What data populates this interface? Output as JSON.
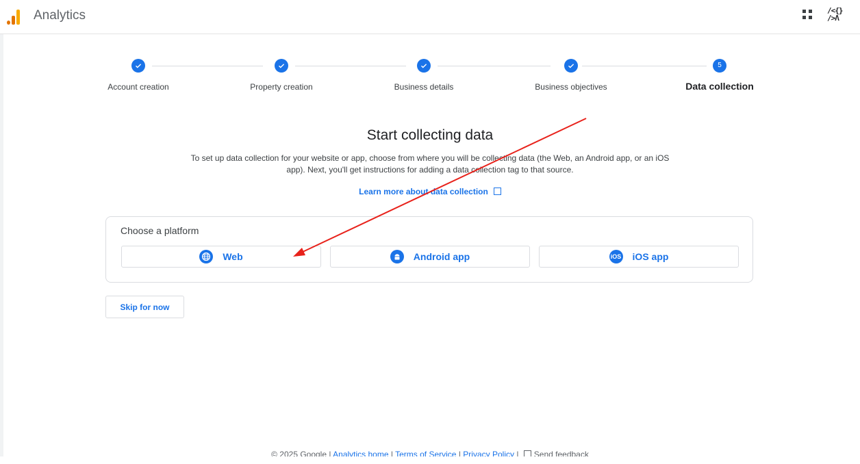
{
  "topbar": {
    "app_title": "Analytics",
    "account_icon_text": "/<{}\n/>Λ"
  },
  "stepper": {
    "steps": [
      {
        "label": "Account creation",
        "state": "done"
      },
      {
        "label": "Property creation",
        "state": "done"
      },
      {
        "label": "Business details",
        "state": "done"
      },
      {
        "label": "Business objectives",
        "state": "done"
      },
      {
        "label": "Data collection",
        "state": "active",
        "number": "5"
      }
    ]
  },
  "main": {
    "heading": "Start collecting data",
    "description": "To set up data collection for your website or app, choose from where you will be collecting data (the Web, an Android app, or an iOS app). Next, you'll get instructions for adding a data collection tag to that source.",
    "learn_more": "Learn more about data collection"
  },
  "platform_card": {
    "title": "Choose a platform",
    "buttons": [
      {
        "label": "Web",
        "icon": "globe-icon"
      },
      {
        "label": "Android app",
        "icon": "android-icon"
      },
      {
        "label": "iOS app",
        "icon": "ios-icon",
        "icon_text": "iOS"
      }
    ]
  },
  "skip_label": "Skip for now",
  "footer": {
    "copyright": "© 2025 Google |",
    "analytics_home": "Analytics home",
    "sep": "|",
    "terms": "Terms of Service",
    "privacy": "Privacy Policy",
    "feedback": "Send feedback"
  },
  "colors": {
    "accent": "#1a73e8",
    "annotation_arrow": "#e8221b",
    "logo_orange": "#e37400",
    "logo_yellow": "#f9ab00"
  }
}
